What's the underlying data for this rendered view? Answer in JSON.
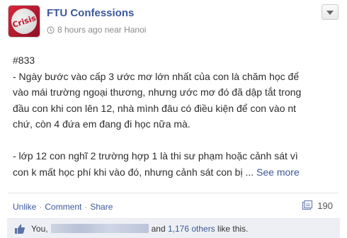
{
  "header": {
    "page_name": "FTU Confessions",
    "timestamp": "8 hours ago near Hanoi",
    "avatar_text": "Crisis"
  },
  "post": {
    "number": "#833",
    "paragraph1": "- Ngày bước vào cấp 3 ước mơ lớn nhất của con là chăm học để\nvào mái trường ngoại thương, nhưng ước mơ đó đã dập tắt trong\nđầu con khi con lên 12, nhà mình đâu có điều kiện để con vào nt\nchứ, còn 4 đứa em đang đi học nữa mà.",
    "paragraph2": "- lớp 12 con nghĩ 2 trường hợp 1 là thi sư phạm hoặc cảnh sát vì\ncon k mất học phí khi vào đó, nhưng cảnh sát con bị ...",
    "see_more": "See more"
  },
  "actions": {
    "unlike": "Unlike",
    "comment": "Comment",
    "share": "Share",
    "share_count": "190"
  },
  "likes": {
    "you": "You,",
    "and": "and",
    "others_count": "1,176 others",
    "suffix": "like this."
  },
  "icons": {
    "clock": "clock-icon",
    "menu": "chevron-down-icon",
    "share": "share-icon",
    "like": "thumbs-up-icon"
  },
  "colors": {
    "link": "#3b5998",
    "like_bar_bg": "#edeff4"
  }
}
